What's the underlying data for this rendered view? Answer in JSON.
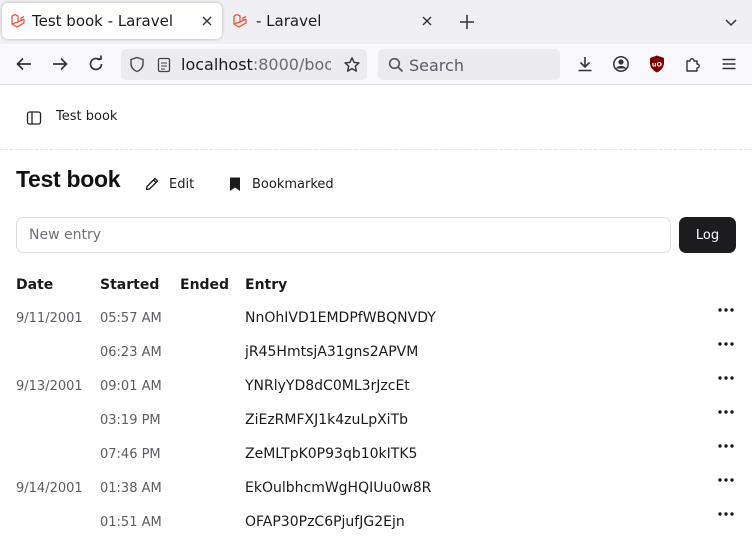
{
  "browser": {
    "tabs": [
      {
        "title": "Test book - Laravel",
        "active": true
      },
      {
        "title": "- Laravel",
        "active": false
      }
    ],
    "url_host": "localhost",
    "url_path": ":8000/boo",
    "search_placeholder": "Search"
  },
  "header": {
    "breadcrumb": "Test book"
  },
  "book": {
    "title": "Test book",
    "edit_label": "Edit",
    "bookmark_label": "Bookmarked"
  },
  "form": {
    "placeholder": "New entry",
    "log_label": "Log"
  },
  "table": {
    "headers": {
      "date": "Date",
      "started": "Started",
      "ended": "Ended",
      "entry": "Entry"
    },
    "rows": [
      {
        "date": "9/11/2001",
        "started": "05:57 AM",
        "ended": "",
        "entry": "NnOhIVD1EMDPfWBQNVDY"
      },
      {
        "date": "",
        "started": "06:23 AM",
        "ended": "",
        "entry": "jR45HmtsjA31gns2APVM"
      },
      {
        "date": "9/13/2001",
        "started": "09:01 AM",
        "ended": "",
        "entry": "YNRlyYD8dC0ML3rJzcEt"
      },
      {
        "date": "",
        "started": "03:19 PM",
        "ended": "",
        "entry": "ZiEzRMFXJ1k4zuLpXiTb"
      },
      {
        "date": "",
        "started": "07:46 PM",
        "ended": "",
        "entry": "ZeMLTpK0P93qb10kITK5"
      },
      {
        "date": "9/14/2001",
        "started": "01:38 AM",
        "ended": "",
        "entry": "EkOulbhcmWgHQIUu0w8R"
      },
      {
        "date": "",
        "started": "01:51 AM",
        "ended": "",
        "entry": "OFAP30PzC6PjufJG2Ejn"
      }
    ]
  },
  "colors": {
    "accent_dark": "#1c1c1e",
    "tab_strip": "#f0f0f4",
    "ublock_red": "#800000"
  }
}
